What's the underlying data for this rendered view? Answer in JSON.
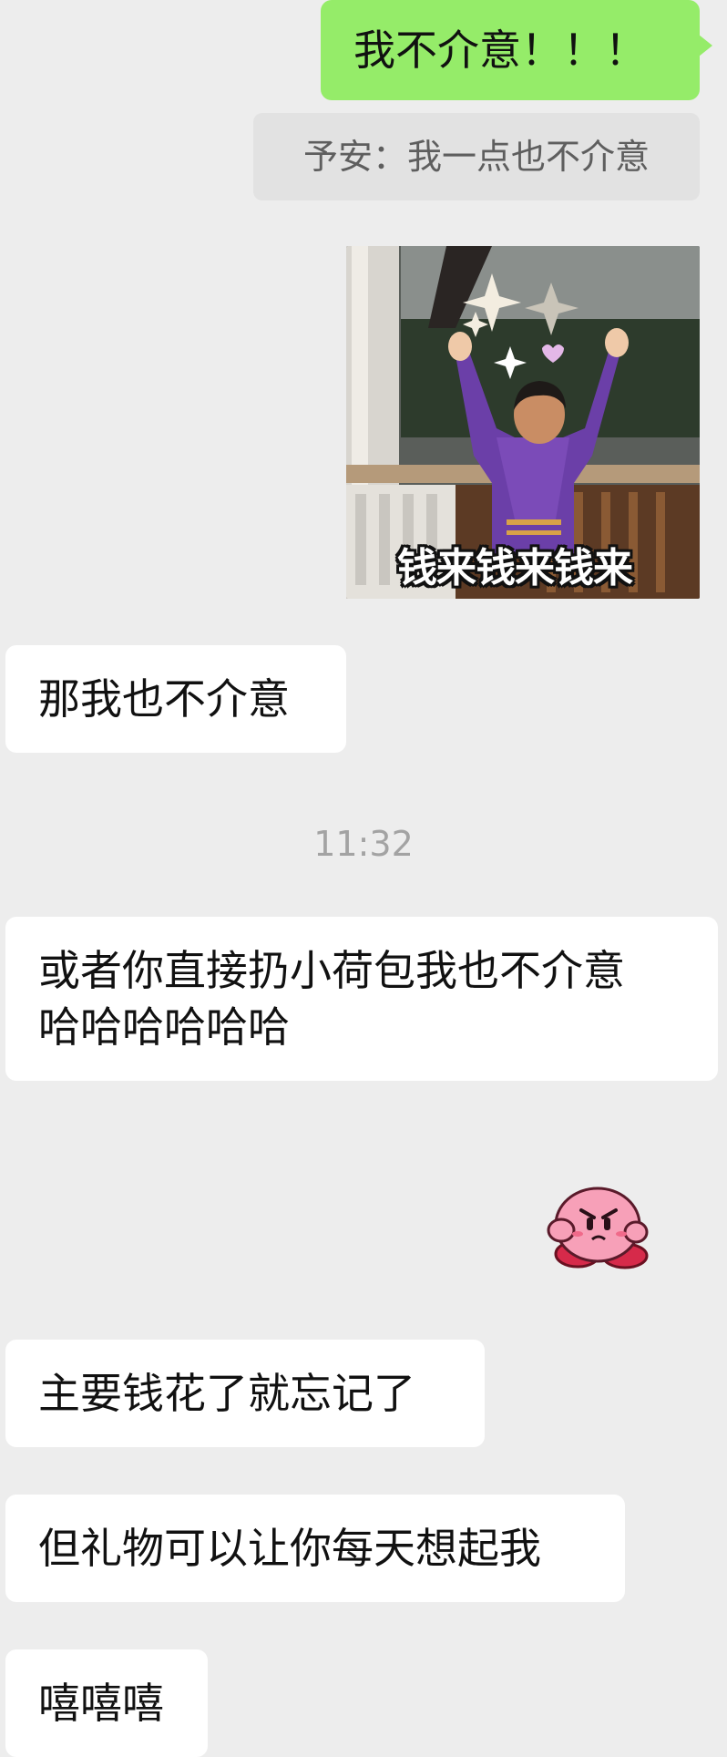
{
  "chat": {
    "messages": [
      {
        "side": "outgoing",
        "type": "text",
        "text": "我不介意！！！"
      },
      {
        "side": "outgoing",
        "type": "quote",
        "text": "予安：我一点也不介意"
      },
      {
        "side": "outgoing",
        "type": "sticker",
        "sticker": "money-dance-sticker",
        "caption": "钱来钱来钱来"
      },
      {
        "side": "incoming",
        "type": "text",
        "text": "那我也不介意"
      },
      {
        "type": "timestamp",
        "text": "11:32"
      },
      {
        "side": "incoming",
        "type": "text",
        "lines": [
          "或者你直接扔小荷包我也不介意",
          "哈哈哈哈哈哈"
        ]
      },
      {
        "side": "outgoing",
        "type": "sticker",
        "sticker": "pouting-kirby-sticker"
      },
      {
        "side": "incoming",
        "type": "text",
        "text": "主要钱花了就忘记了"
      },
      {
        "side": "incoming",
        "type": "text",
        "text": "但礼物可以让你每天想起我"
      },
      {
        "side": "incoming",
        "type": "text",
        "text": "嘻嘻嘻"
      }
    ]
  },
  "colors": {
    "background": "#ededed",
    "outgoing_bubble": "#95ec69",
    "incoming_bubble": "#ffffff",
    "quote_background": "#e2e2e2",
    "timestamp_text": "#a3a3a3"
  }
}
